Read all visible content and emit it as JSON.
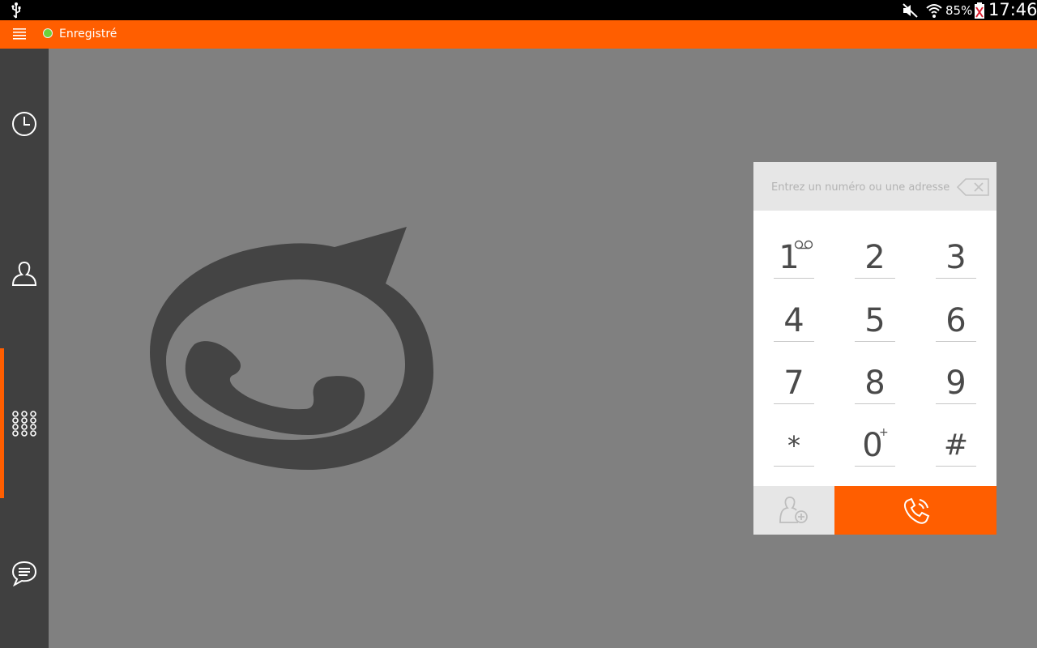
{
  "status_bar": {
    "battery": "85%",
    "time": "17:46",
    "icons": [
      "usb-icon",
      "mute-icon",
      "wifi-icon",
      "battery-icon"
    ]
  },
  "top_bar": {
    "status_label": "Enregistré",
    "status_color": "#6cd23a",
    "accent": "#ff5e00"
  },
  "sidebar": {
    "items": [
      {
        "name": "history",
        "icon": "clock-icon"
      },
      {
        "name": "contacts",
        "icon": "person-icon"
      },
      {
        "name": "dialer",
        "icon": "dialpad-icon",
        "active": true
      },
      {
        "name": "chat",
        "icon": "chat-bubble-icon"
      }
    ]
  },
  "dialer": {
    "placeholder": "Entrez un numéro ou une adresse",
    "keys": [
      {
        "digit": "1",
        "sub": "voicemail-icon"
      },
      {
        "digit": "2"
      },
      {
        "digit": "3"
      },
      {
        "digit": "4"
      },
      {
        "digit": "5"
      },
      {
        "digit": "6"
      },
      {
        "digit": "7"
      },
      {
        "digit": "8"
      },
      {
        "digit": "9"
      },
      {
        "digit": "*"
      },
      {
        "digit": "0",
        "sub": "+"
      },
      {
        "digit": "#"
      }
    ]
  }
}
